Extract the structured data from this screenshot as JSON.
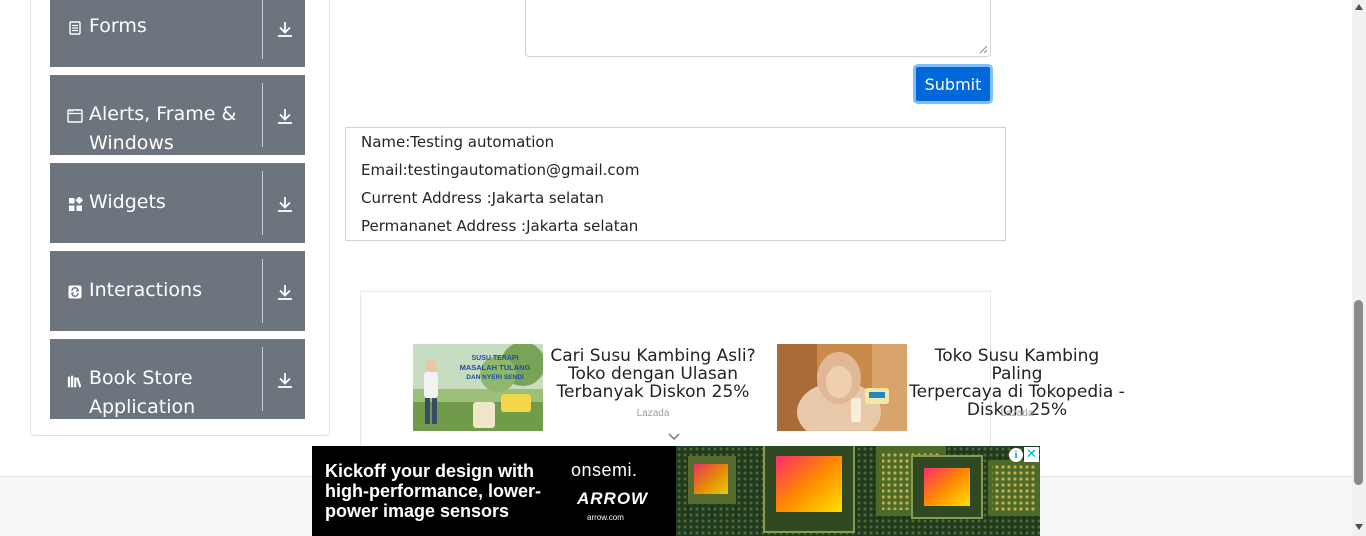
{
  "sidebar": {
    "groups": [
      {
        "label": "Forms",
        "icon": "document-icon"
      },
      {
        "label": "Alerts, Frame &",
        "label2": "Windows",
        "icon": "window-icon"
      },
      {
        "label": "Widgets",
        "icon": "widgets-icon"
      },
      {
        "label": "Interactions",
        "icon": "interactions-icon"
      },
      {
        "label": "Book Store",
        "label2": "Application",
        "icon": "books-icon"
      }
    ],
    "download_icon": "download-arrow-icon"
  },
  "form": {
    "submit_label": "Submit"
  },
  "output": {
    "name": "Name:Testing automation",
    "email": "Email:testingautomation@gmail.com",
    "current_address": "Current Address :Jakarta selatan",
    "permanent_address": "Permananet Address :Jakarta selatan"
  },
  "ads": {
    "items": [
      {
        "title_l1": "Cari Susu Kambing Asli?",
        "title_l2": "Toko dengan Ulasan",
        "title_l3": "Terbanyak Diskon 25%",
        "source": "Lazada",
        "image_text_1": "SUSU TERAPI",
        "image_text_2": "MASALAH TULANG",
        "image_text_3": "DAN NYERI SENDI"
      },
      {
        "title_l1": "Toko Susu Kambing Paling",
        "title_l2": "Terpercaya di Tokopedia -",
        "title_l3": "Diskon 25%",
        "source": "Lazada"
      }
    ],
    "banner": {
      "headline_l1": "Kickoff your design with",
      "headline_l2": "high-performance, lower-",
      "headline_l3": "power image sensors",
      "brand_1": "onsemi.",
      "brand_2": "ARROW",
      "brand_3": "arrow.com",
      "adchoice_glyph": "i",
      "close_glyph": "✕"
    }
  },
  "colors": {
    "sidebar_group_bg": "#6c757d",
    "submit_bg": "#0069d9",
    "submit_ring": "#80bdff",
    "banner_bg": "#000000",
    "accent_teal": "#00aecd"
  }
}
